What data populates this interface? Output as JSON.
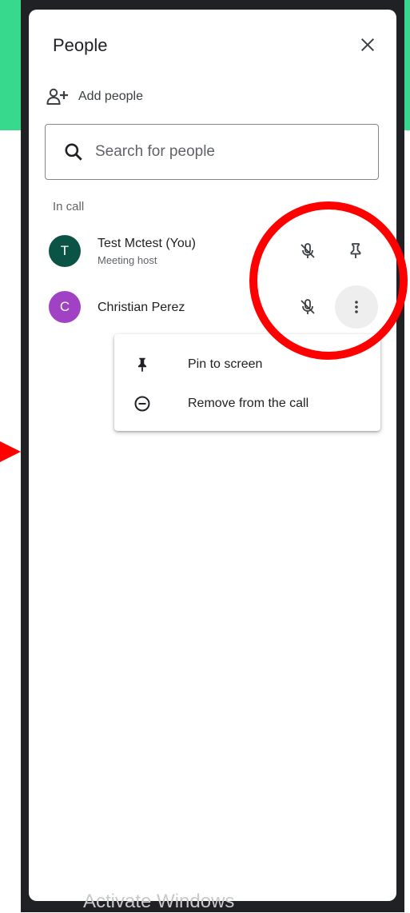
{
  "panel": {
    "title": "People",
    "add_people_label": "Add people",
    "search_placeholder": "Search for people",
    "section_label": "In call"
  },
  "participants": [
    {
      "initial": "T",
      "name": "Test Mctest (You)",
      "subtitle": "Meeting host",
      "avatar_color": "#0b5345"
    },
    {
      "initial": "C",
      "name": "Christian Perez",
      "subtitle": "",
      "avatar_color": "#a142c4"
    }
  ],
  "context_menu": {
    "items": [
      {
        "label": "Pin to screen",
        "icon": "pin-icon"
      },
      {
        "label": "Remove from the call",
        "icon": "remove-circle-icon"
      }
    ]
  },
  "overlay": {
    "watermark": "Activate Windows",
    "annotation_color": "#ff0000",
    "background_accent": "#37d98c"
  }
}
